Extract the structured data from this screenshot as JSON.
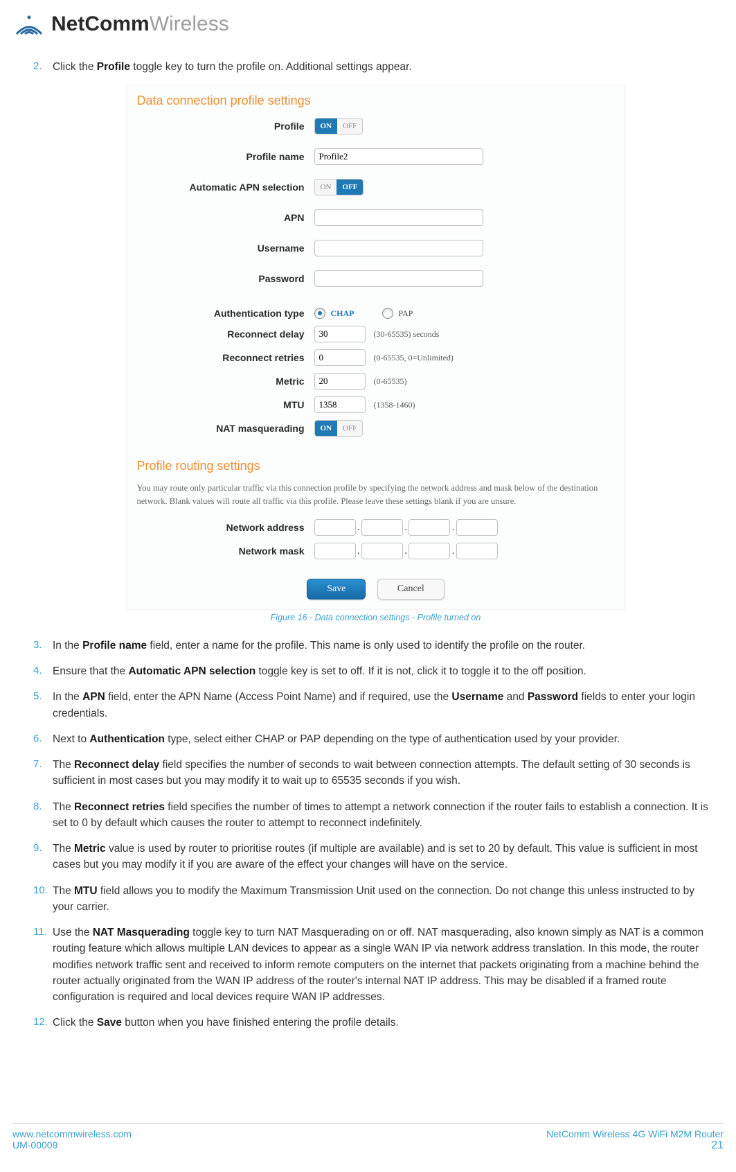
{
  "brand": {
    "part1": "NetComm",
    "part2": "Wireless"
  },
  "steps": {
    "s2": {
      "num": "2.",
      "pre": "Click the ",
      "b1": "Profile",
      "post": " toggle key to turn the profile on. Additional settings appear."
    },
    "s3": {
      "num": "3.",
      "pre": "In the ",
      "b1": "Profile name",
      "post": " field, enter a name for the profile. This name is only used to identify the profile on the router."
    },
    "s4": {
      "num": "4.",
      "pre": "Ensure that the ",
      "b1": "Automatic APN selection",
      "post": " toggle key is set to off. If it is not, click it to toggle it to the off position."
    },
    "s5": {
      "num": "5.",
      "pre": "In the ",
      "b1": "APN",
      "mid1": " field, enter the APN Name (Access Point Name) and if required, use the ",
      "b2": "Username",
      "mid2": " and ",
      "b3": "Password",
      "post": " fields to enter your login credentials."
    },
    "s6": {
      "num": "6.",
      "pre": "Next to ",
      "b1": "Authentication",
      "post": " type, select either CHAP or PAP depending on the type of authentication used by your provider."
    },
    "s7": {
      "num": "7.",
      "pre": "The ",
      "b1": "Reconnect delay",
      "post": " field specifies the number of seconds to wait between connection attempts. The default setting of 30 seconds is sufficient in most cases but you may modify it to wait up to 65535 seconds if you wish."
    },
    "s8": {
      "num": "8.",
      "pre": "The ",
      "b1": "Reconnect retries",
      "post": " field specifies the number of times to attempt a network connection if the router fails to establish a connection. It is set to 0 by default which causes the router to attempt to reconnect indefinitely."
    },
    "s9": {
      "num": "9.",
      "pre": "The ",
      "b1": "Metric",
      "post": " value is used by router to prioritise routes (if multiple are available) and is set to 20 by default. This value is sufficient in most cases but you may modify it if you are aware of the effect your changes will have on the service."
    },
    "s10": {
      "num": "10.",
      "pre": "The ",
      "b1": "MTU",
      "post": " field allows you to modify the Maximum Transmission Unit used on the connection. Do not change this unless instructed to by your carrier."
    },
    "s11": {
      "num": "11.",
      "pre": "Use the ",
      "b1": "NAT Masquerading",
      "post": " toggle key to turn NAT Masquerading on or off. NAT masquerading, also known simply as NAT is a common routing feature which allows multiple LAN devices to appear as a single WAN IP via network address translation. In this mode, the router modifies network traffic sent and received to inform remote computers on the internet that packets originating from a machine behind the router actually originated from the WAN IP address of the router's internal NAT IP address. This may be disabled if a framed route configuration is required and local devices require WAN IP addresses."
    },
    "s12": {
      "num": "12.",
      "pre": "Click the ",
      "b1": "Save",
      "post": " button when you have finished entering the profile details."
    }
  },
  "figure": {
    "title1": "Data connection profile settings",
    "title2": "Profile routing settings",
    "routing_note": "You may route only particular traffic via this connection profile by specifying the network address and mask below of the destination network. Blank values will route all traffic via this profile. Please leave these settings blank if you are unsure.",
    "caption": "Figure 16 - Data connection settings - Profile turned on",
    "labels": {
      "profile": "Profile",
      "profile_name": "Profile name",
      "auto_apn": "Automatic APN selection",
      "apn": "APN",
      "username": "Username",
      "password": "Password",
      "auth_type": "Authentication type",
      "reconnect_delay": "Reconnect delay",
      "reconnect_retries": "Reconnect retries",
      "metric": "Metric",
      "mtu": "MTU",
      "nat": "NAT masquerading",
      "net_addr": "Network address",
      "net_mask": "Network mask"
    },
    "values": {
      "on": "ON",
      "off": "OFF",
      "profile_name": "Profile2",
      "chap": "CHAP",
      "pap": "PAP",
      "delay": "30",
      "delay_hint": "(30-65535) seconds",
      "retries": "0",
      "retries_hint": "(0-65535, 0=Unlimited)",
      "metric": "20",
      "metric_hint": "(0-65535)",
      "mtu": "1358",
      "mtu_hint": "(1358-1460)",
      "save": "Save",
      "cancel": "Cancel"
    }
  },
  "footer": {
    "url": "www.netcommwireless.com",
    "doc": "UM-00009",
    "product": "NetComm Wireless 4G WiFi M2M Router",
    "page": "21"
  }
}
